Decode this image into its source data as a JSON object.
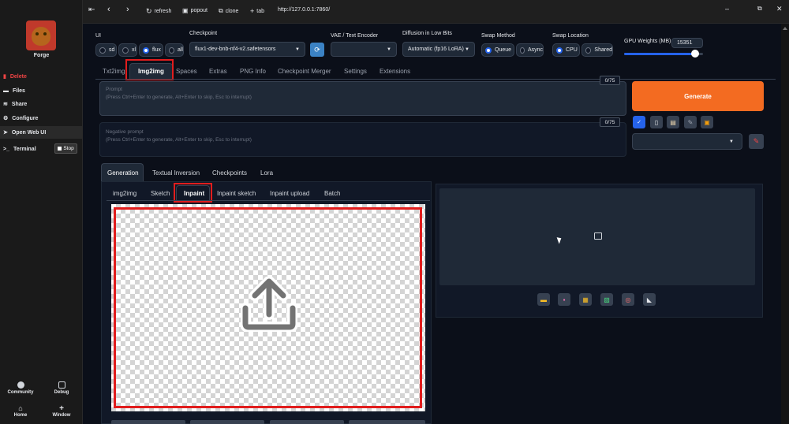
{
  "sidebar": {
    "app_name": "Forge",
    "items": [
      {
        "label": "Delete",
        "icon": "trash-icon"
      },
      {
        "label": "Files",
        "icon": "folder-icon"
      },
      {
        "label": "Share",
        "icon": "wifi-icon"
      },
      {
        "label": "Configure",
        "icon": "gear-icon"
      },
      {
        "label": "Open Web UI",
        "icon": "rocket-icon"
      },
      {
        "label": "Terminal",
        "icon": "terminal-icon"
      }
    ],
    "stop_label": "Stop",
    "bottom": {
      "community": "Community",
      "debug": "Debug",
      "home": "Home",
      "window": "Window"
    }
  },
  "topbar": {
    "refresh": "refresh",
    "popout": "popout",
    "clone": "clone",
    "tab": "tab",
    "url": "http://127.0.0.1:7860/"
  },
  "settings": {
    "ui_label": "UI",
    "ui_options": [
      "sd",
      "xl",
      "flux",
      "all"
    ],
    "ui_selected": "flux",
    "checkpoint_label": "Checkpoint",
    "checkpoint_value": "flux1-dev-bnb-nf4-v2.safetensors",
    "vae_label": "VAE / Text Encoder",
    "vae_value": "",
    "diffusion_label": "Diffusion in Low Bits",
    "diffusion_value": "Automatic (fp16 LoRA)",
    "swap_method_label": "Swap Method",
    "swap_method_options": [
      "Queue",
      "Async"
    ],
    "swap_method_selected": "Queue",
    "swap_location_label": "Swap Location",
    "swap_location_options": [
      "CPU",
      "Shared"
    ],
    "swap_location_selected": "CPU",
    "gpu_weights_label": "GPU Weights (MB)",
    "gpu_weights_value": "15351",
    "gpu_weights_fraction": 0.9
  },
  "main_tabs": [
    "Txt2img",
    "Img2img",
    "Spaces",
    "Extras",
    "PNG Info",
    "Checkpoint Merger",
    "Settings",
    "Extensions"
  ],
  "main_tab_active": "Img2img",
  "prompt": {
    "label": "Prompt",
    "placeholder": "(Press Ctrl+Enter to generate, Alt+Enter to skip, Esc to interrupt)",
    "counter": "0/75"
  },
  "negative_prompt": {
    "label": "Negative prompt",
    "placeholder": "(Press Ctrl+Enter to generate, Alt+Enter to skip, Esc to interrupt)",
    "counter": "0/75"
  },
  "generate_label": "Generate",
  "style_value": "",
  "sub_tabs": [
    "Generation",
    "Textual Inversion",
    "Checkpoints",
    "Lora"
  ],
  "sub_tab_active": "Generation",
  "img_tabs": [
    "img2img",
    "Sketch",
    "Inpaint",
    "Inpaint sketch",
    "Inpaint upload",
    "Batch"
  ],
  "img_tab_active": "Inpaint",
  "colors": {
    "accent": "#f97316",
    "highlight": "#e11d1d",
    "link": "#2563eb"
  }
}
